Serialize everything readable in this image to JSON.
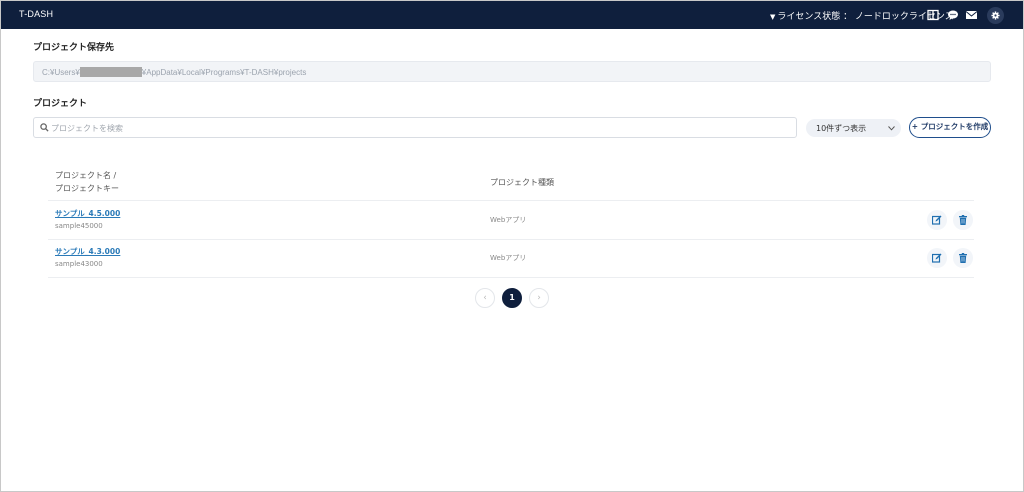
{
  "header": {
    "app_title": "T-DASH",
    "license_label": "ライセンス状態 ： ノードロックライセンス",
    "icons": [
      "manual-book-icon",
      "chat-icon",
      "mail-icon",
      "gear-icon"
    ]
  },
  "save_location": {
    "label": "プロジェクト保存先",
    "path_prefix": "C:¥Users¥",
    "path_suffix": "¥AppData¥Local¥Programs¥T-DASH¥projects"
  },
  "projects": {
    "label": "プロジェクト",
    "search_placeholder": "プロジェクトを検索",
    "per_page": "10件ずつ表示",
    "create_button": "+ プロジェクトを作成",
    "columns": {
      "name_line1": "プロジェクト名 /",
      "name_line2": "プロジェクトキー",
      "type": "プロジェクト種類"
    },
    "rows": [
      {
        "name": "サンプル_4.5.000",
        "key": "sample45000",
        "type": "Webアプリ"
      },
      {
        "name": "サンプル_4.3.000",
        "key": "sample43000",
        "type": "Webアプリ"
      }
    ]
  },
  "pagination": {
    "prev": "‹",
    "current": "1",
    "next": "›"
  },
  "colors": {
    "header_bg": "#0f1f3d",
    "link": "#2a7ab8",
    "accent": "#1f4e8c"
  }
}
